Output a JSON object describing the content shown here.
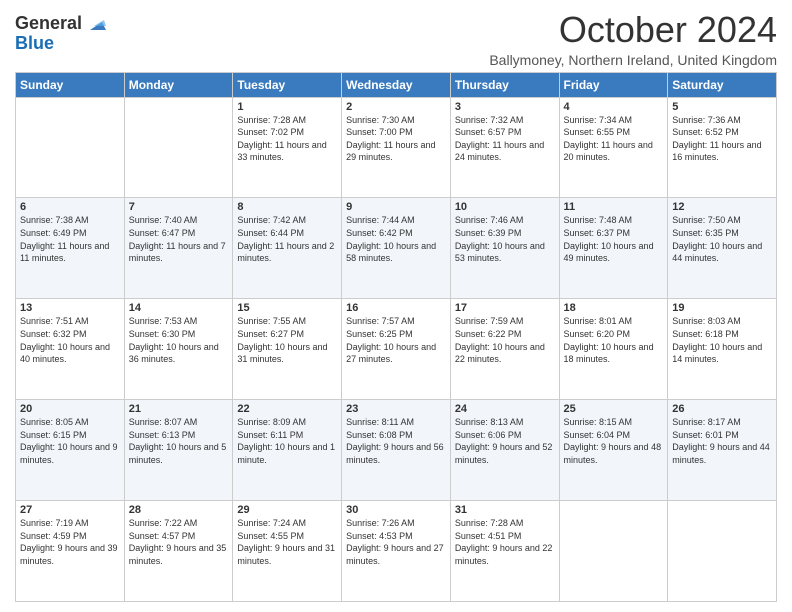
{
  "logo": {
    "line1": "General",
    "line2": "Blue"
  },
  "title": "October 2024",
  "subtitle": "Ballymoney, Northern Ireland, United Kingdom",
  "days_of_week": [
    "Sunday",
    "Monday",
    "Tuesday",
    "Wednesday",
    "Thursday",
    "Friday",
    "Saturday"
  ],
  "weeks": [
    [
      {
        "day": "",
        "info": ""
      },
      {
        "day": "",
        "info": ""
      },
      {
        "day": "1",
        "info": "Sunrise: 7:28 AM\nSunset: 7:02 PM\nDaylight: 11 hours and 33 minutes."
      },
      {
        "day": "2",
        "info": "Sunrise: 7:30 AM\nSunset: 7:00 PM\nDaylight: 11 hours and 29 minutes."
      },
      {
        "day": "3",
        "info": "Sunrise: 7:32 AM\nSunset: 6:57 PM\nDaylight: 11 hours and 24 minutes."
      },
      {
        "day": "4",
        "info": "Sunrise: 7:34 AM\nSunset: 6:55 PM\nDaylight: 11 hours and 20 minutes."
      },
      {
        "day": "5",
        "info": "Sunrise: 7:36 AM\nSunset: 6:52 PM\nDaylight: 11 hours and 16 minutes."
      }
    ],
    [
      {
        "day": "6",
        "info": "Sunrise: 7:38 AM\nSunset: 6:49 PM\nDaylight: 11 hours and 11 minutes."
      },
      {
        "day": "7",
        "info": "Sunrise: 7:40 AM\nSunset: 6:47 PM\nDaylight: 11 hours and 7 minutes."
      },
      {
        "day": "8",
        "info": "Sunrise: 7:42 AM\nSunset: 6:44 PM\nDaylight: 11 hours and 2 minutes."
      },
      {
        "day": "9",
        "info": "Sunrise: 7:44 AM\nSunset: 6:42 PM\nDaylight: 10 hours and 58 minutes."
      },
      {
        "day": "10",
        "info": "Sunrise: 7:46 AM\nSunset: 6:39 PM\nDaylight: 10 hours and 53 minutes."
      },
      {
        "day": "11",
        "info": "Sunrise: 7:48 AM\nSunset: 6:37 PM\nDaylight: 10 hours and 49 minutes."
      },
      {
        "day": "12",
        "info": "Sunrise: 7:50 AM\nSunset: 6:35 PM\nDaylight: 10 hours and 44 minutes."
      }
    ],
    [
      {
        "day": "13",
        "info": "Sunrise: 7:51 AM\nSunset: 6:32 PM\nDaylight: 10 hours and 40 minutes."
      },
      {
        "day": "14",
        "info": "Sunrise: 7:53 AM\nSunset: 6:30 PM\nDaylight: 10 hours and 36 minutes."
      },
      {
        "day": "15",
        "info": "Sunrise: 7:55 AM\nSunset: 6:27 PM\nDaylight: 10 hours and 31 minutes."
      },
      {
        "day": "16",
        "info": "Sunrise: 7:57 AM\nSunset: 6:25 PM\nDaylight: 10 hours and 27 minutes."
      },
      {
        "day": "17",
        "info": "Sunrise: 7:59 AM\nSunset: 6:22 PM\nDaylight: 10 hours and 22 minutes."
      },
      {
        "day": "18",
        "info": "Sunrise: 8:01 AM\nSunset: 6:20 PM\nDaylight: 10 hours and 18 minutes."
      },
      {
        "day": "19",
        "info": "Sunrise: 8:03 AM\nSunset: 6:18 PM\nDaylight: 10 hours and 14 minutes."
      }
    ],
    [
      {
        "day": "20",
        "info": "Sunrise: 8:05 AM\nSunset: 6:15 PM\nDaylight: 10 hours and 9 minutes."
      },
      {
        "day": "21",
        "info": "Sunrise: 8:07 AM\nSunset: 6:13 PM\nDaylight: 10 hours and 5 minutes."
      },
      {
        "day": "22",
        "info": "Sunrise: 8:09 AM\nSunset: 6:11 PM\nDaylight: 10 hours and 1 minute."
      },
      {
        "day": "23",
        "info": "Sunrise: 8:11 AM\nSunset: 6:08 PM\nDaylight: 9 hours and 56 minutes."
      },
      {
        "day": "24",
        "info": "Sunrise: 8:13 AM\nSunset: 6:06 PM\nDaylight: 9 hours and 52 minutes."
      },
      {
        "day": "25",
        "info": "Sunrise: 8:15 AM\nSunset: 6:04 PM\nDaylight: 9 hours and 48 minutes."
      },
      {
        "day": "26",
        "info": "Sunrise: 8:17 AM\nSunset: 6:01 PM\nDaylight: 9 hours and 44 minutes."
      }
    ],
    [
      {
        "day": "27",
        "info": "Sunrise: 7:19 AM\nSunset: 4:59 PM\nDaylight: 9 hours and 39 minutes."
      },
      {
        "day": "28",
        "info": "Sunrise: 7:22 AM\nSunset: 4:57 PM\nDaylight: 9 hours and 35 minutes."
      },
      {
        "day": "29",
        "info": "Sunrise: 7:24 AM\nSunset: 4:55 PM\nDaylight: 9 hours and 31 minutes."
      },
      {
        "day": "30",
        "info": "Sunrise: 7:26 AM\nSunset: 4:53 PM\nDaylight: 9 hours and 27 minutes."
      },
      {
        "day": "31",
        "info": "Sunrise: 7:28 AM\nSunset: 4:51 PM\nDaylight: 9 hours and 22 minutes."
      },
      {
        "day": "",
        "info": ""
      },
      {
        "day": "",
        "info": ""
      }
    ]
  ]
}
